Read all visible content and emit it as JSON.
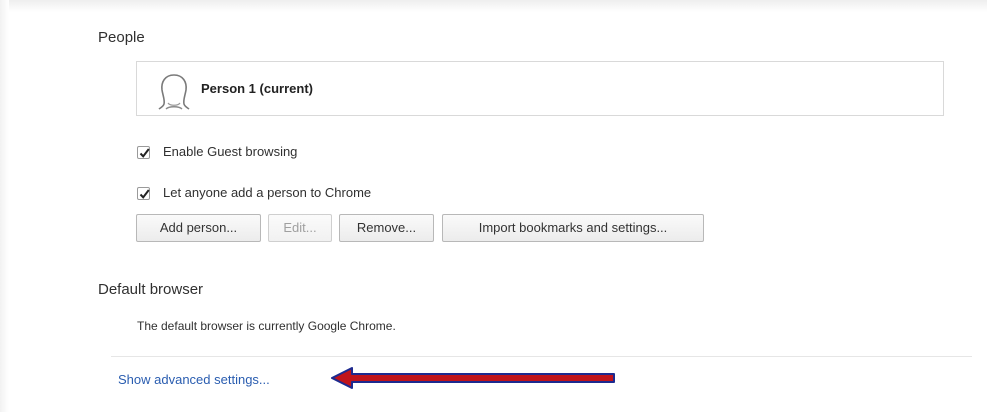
{
  "people": {
    "title": "People",
    "current_person": "Person 1 (current)",
    "checkboxes": [
      {
        "label": "Enable Guest browsing",
        "checked": true
      },
      {
        "label": "Let anyone add a person to Chrome",
        "checked": true
      }
    ],
    "buttons": {
      "add": "Add person...",
      "edit": "Edit...",
      "remove": "Remove...",
      "import": "Import bookmarks and settings..."
    }
  },
  "default_browser": {
    "title": "Default browser",
    "status": "The default browser is currently Google Chrome."
  },
  "advanced": {
    "link": "Show advanced settings..."
  },
  "annotation": {
    "arrow_fill": "#c0141b",
    "arrow_outline": "#1d2a8f"
  }
}
